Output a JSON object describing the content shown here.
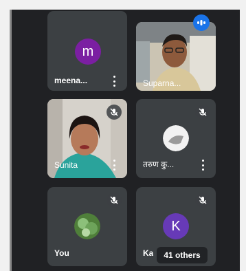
{
  "participants": [
    {
      "name": "meena...",
      "avatar_letter": "m",
      "avatar_color": "#7b1fa2"
    },
    {
      "name": "Suparna...",
      "video": true
    },
    {
      "name": "Sunita",
      "video": true,
      "muted": true
    },
    {
      "name": "तरुण कु...",
      "muted": true
    },
    {
      "name": "You",
      "muted": true
    },
    {
      "name": "Ka",
      "avatar_letter": "K",
      "avatar_color": "#673ab7",
      "muted": true
    }
  ],
  "others_label": "41 others",
  "colors": {
    "tile_bg": "#3c4043",
    "stage_bg": "#202124",
    "accent_blue": "#1a73e8"
  }
}
